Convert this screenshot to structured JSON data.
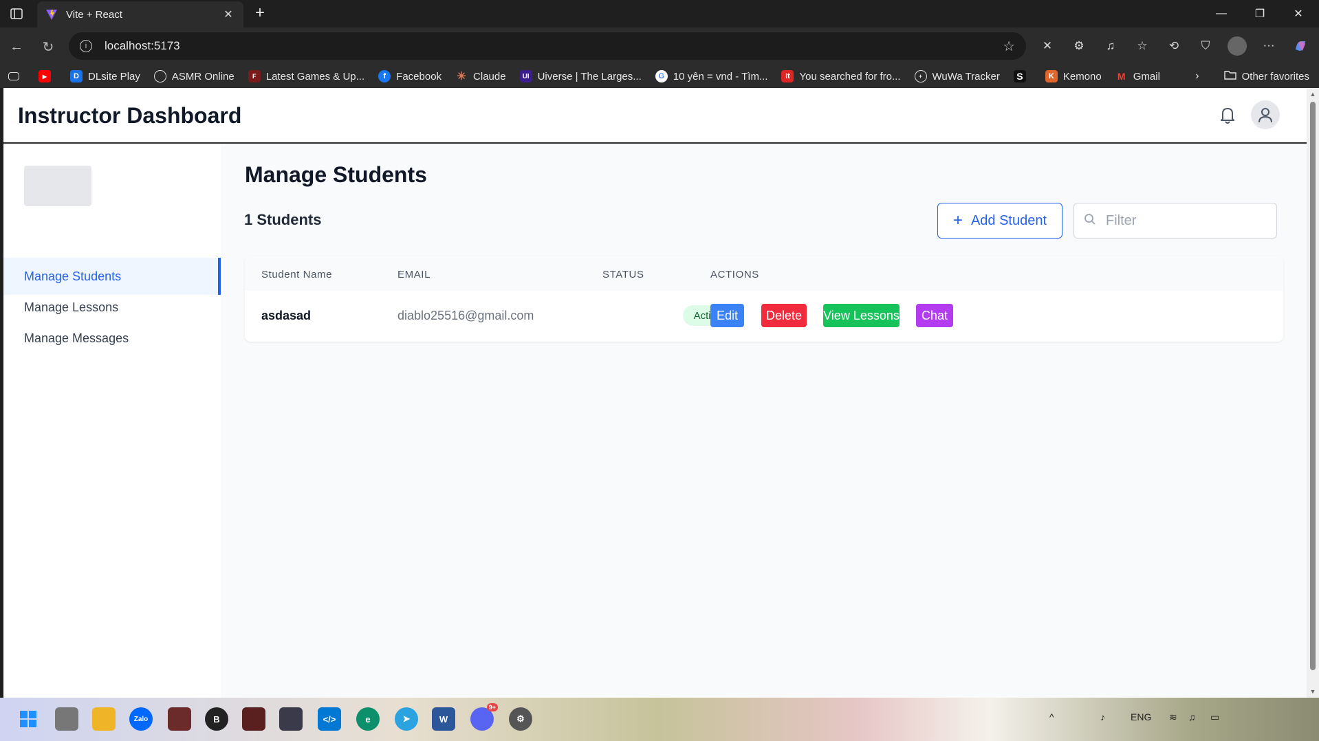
{
  "browser": {
    "tab_title": "Vite + React",
    "url": "localhost:5173",
    "bookmarks": [
      {
        "label": "",
        "color": "#ff0000",
        "glyph": "▶"
      },
      {
        "label": "DLsite Play",
        "color": "#1a73e8",
        "glyph": "D"
      },
      {
        "label": "ASMR Online",
        "color": "#555555",
        "glyph": "◎"
      },
      {
        "label": "Latest Games & Up...",
        "color": "#7a1a1a",
        "glyph": "F"
      },
      {
        "label": "Facebook",
        "color": "#1877f2",
        "glyph": "f"
      },
      {
        "label": "Claude",
        "color": "#d97757",
        "glyph": "✳"
      },
      {
        "label": "Uiverse | The Larges...",
        "color": "#3b1d8f",
        "glyph": "U"
      },
      {
        "label": "10 yên = vnd - Tìm...",
        "color": "#ffffff",
        "glyph": "G"
      },
      {
        "label": "You searched for fro...",
        "color": "#e02424",
        "glyph": "it"
      },
      {
        "label": "WuWa Tracker",
        "color": "#444444",
        "glyph": "⊕"
      },
      {
        "label": "",
        "color": "#111111",
        "glyph": "S"
      },
      {
        "label": "Kemono",
        "color": "#e0662b",
        "glyph": "K"
      },
      {
        "label": "Gmail",
        "color": "#ea4335",
        "glyph": "M"
      }
    ],
    "other_favorites": "Other favorites"
  },
  "header": {
    "title": "Instructor Dashboard"
  },
  "sidebar": {
    "items": [
      {
        "label": "Manage Students",
        "active": true
      },
      {
        "label": "Manage Lessons",
        "active": false
      },
      {
        "label": "Manage Messages",
        "active": false
      }
    ]
  },
  "main": {
    "title": "Manage Students",
    "count_label": "1 Students",
    "add_button": "Add Student",
    "filter_placeholder": "Filter",
    "table": {
      "headers": [
        "Student Name",
        "EMAIL",
        "STATUS",
        "ACTIONS"
      ],
      "rows": [
        {
          "name": "asdasad",
          "email": "diablo25516@gmail.com",
          "status": "Active",
          "actions": [
            "Edit",
            "Delete",
            "View Lessons",
            "Chat"
          ]
        }
      ]
    }
  },
  "colors": {
    "primary": "#2563eb",
    "edit": "#3b82f6",
    "delete": "#ef2b3c",
    "view_lessons": "#16c35a",
    "chat": "#b33bf0",
    "status_active_bg": "#dcfce7"
  },
  "taskbar": {
    "language": "ENG",
    "badge": "9+"
  }
}
